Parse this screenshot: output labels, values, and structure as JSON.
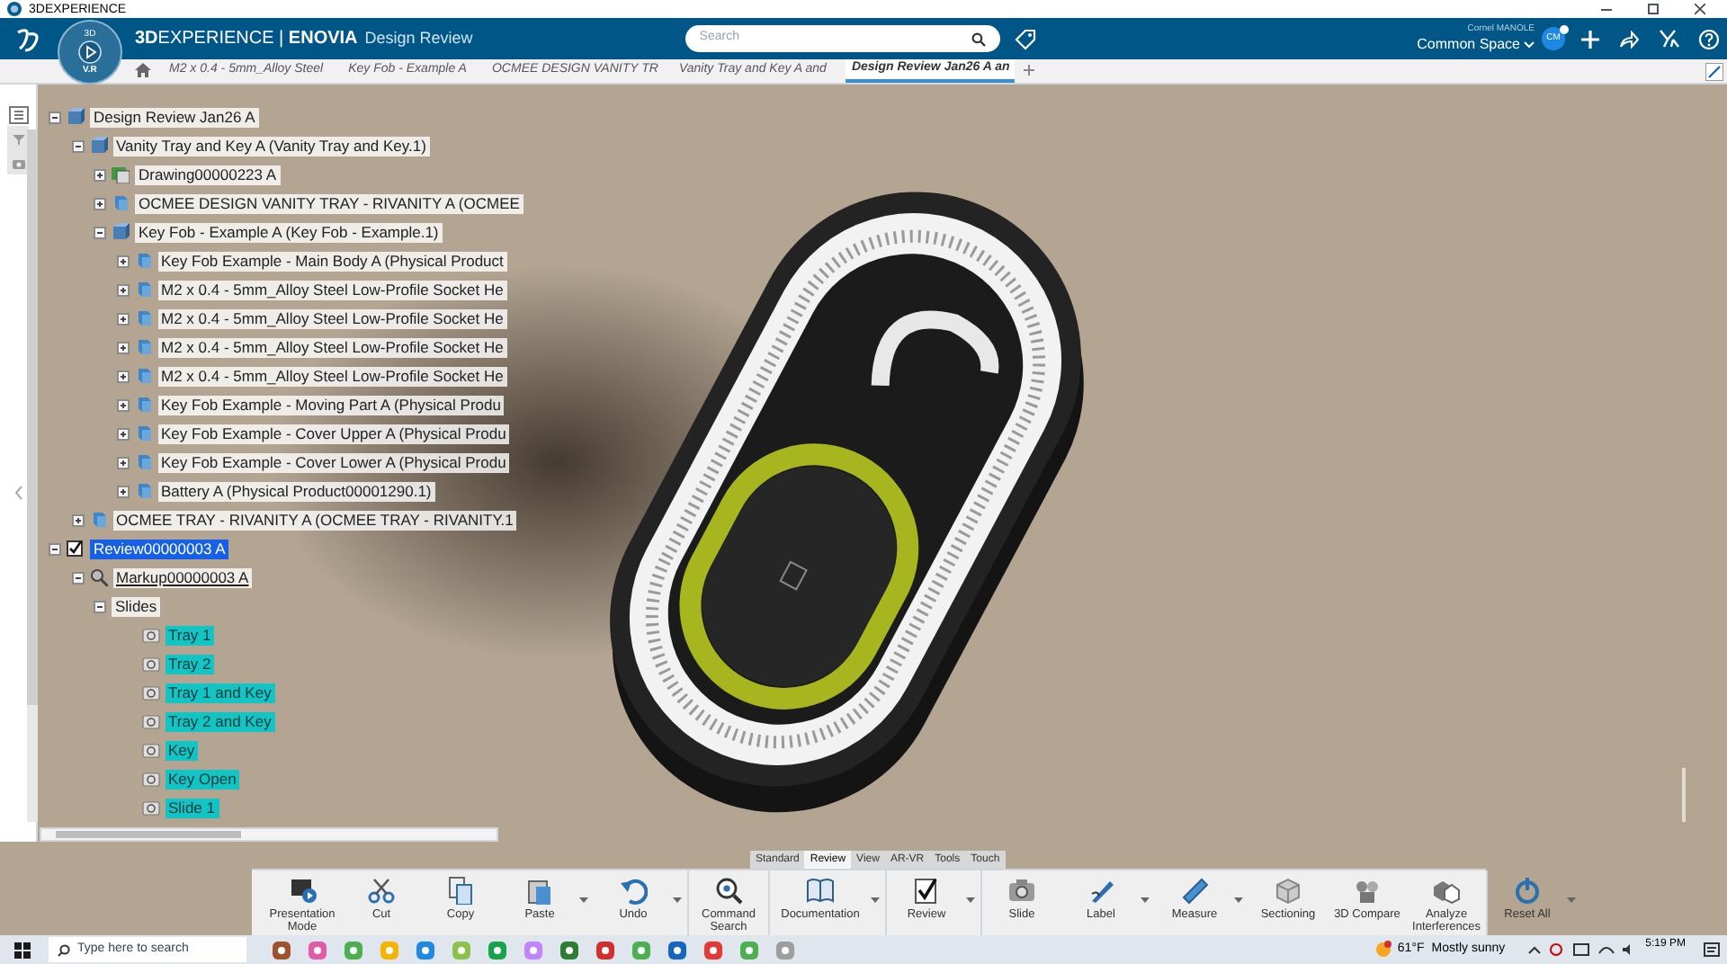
{
  "window": {
    "title": "3DEXPERIENCE"
  },
  "top_bar": {
    "brand": "**3D**EXPERIENCE | **ENOVIA**",
    "app": "Design Review",
    "compass": {
      "top": "3D",
      "bottom": "V.R"
    },
    "search": {
      "placeholder": "Search"
    },
    "user": "Cornel MANOLE",
    "space": "Common Space",
    "avatar": "CM"
  },
  "tabs": [
    {
      "label": "M2 x 0.4 - 5mm_Alloy Steel",
      "selected": false
    },
    {
      "label": "Key Fob - Example A",
      "selected": false
    },
    {
      "label": "OCMEE DESIGN VANITY TR",
      "selected": false
    },
    {
      "label": "Vanity Tray and Key A and",
      "selected": false
    },
    {
      "label": "Design Review Jan26 A an",
      "selected": true
    }
  ],
  "tree": [
    {
      "label": "Design Review Jan26 A",
      "kind": "product",
      "expanded": true,
      "selected": false,
      "children": [
        {
          "label": "Vanity Tray and Key A (Vanity Tray and Key.1)",
          "kind": "product",
          "expanded": true,
          "selected": false,
          "children": [
            {
              "label": "Drawing00000223 A",
              "kind": "drawing",
              "expanded": false,
              "selected": false
            },
            {
              "label": "OCMEE DESIGN VANITY TRAY - RIVANITY A (OCMEE",
              "kind": "part",
              "expanded": false,
              "selected": false
            },
            {
              "label": "Key Fob - Example A (Key Fob - Example.1)",
              "kind": "product",
              "expanded": true,
              "selected": false,
              "children": [
                {
                  "label": "Key Fob Example - Main Body A (Physical Product",
                  "kind": "part",
                  "expanded": false,
                  "selected": false
                },
                {
                  "label": "M2 x 0.4 - 5mm_Alloy Steel Low-Profile Socket He",
                  "kind": "part",
                  "expanded": false,
                  "selected": false
                },
                {
                  "label": "M2 x 0.4 - 5mm_Alloy Steel Low-Profile Socket He",
                  "kind": "part",
                  "expanded": false,
                  "selected": false
                },
                {
                  "label": "M2 x 0.4 - 5mm_Alloy Steel Low-Profile Socket He",
                  "kind": "part",
                  "expanded": false,
                  "selected": false
                },
                {
                  "label": "M2 x 0.4 - 5mm_Alloy Steel Low-Profile Socket He",
                  "kind": "part",
                  "expanded": false,
                  "selected": false
                },
                {
                  "label": "Key Fob Example - Moving Part A (Physical Produ",
                  "kind": "part",
                  "expanded": false,
                  "selected": false
                },
                {
                  "label": "Key Fob Example - Cover Upper A (Physical Produ",
                  "kind": "part",
                  "expanded": false,
                  "selected": false
                },
                {
                  "label": "Key Fob Example - Cover Lower A (Physical Produ",
                  "kind": "part",
                  "expanded": false,
                  "selected": false
                },
                {
                  "label": "Battery A (Physical Product00001290.1)",
                  "kind": "part",
                  "expanded": false,
                  "selected": false
                }
              ]
            }
          ]
        },
        {
          "label": "OCMEE TRAY - RIVANITY A (OCMEE TRAY - RIVANITY.1",
          "kind": "part",
          "expanded": false,
          "selected": false
        }
      ]
    },
    {
      "label": "Review00000003 A",
      "kind": "review",
      "expanded": true,
      "selected": true,
      "children": [
        {
          "label": "Markup00000003 A",
          "kind": "markup",
          "expanded": true,
          "selected": false,
          "children": [
            {
              "label": "Slides",
              "kind": "folder",
              "expanded": true,
              "selected": false,
              "children": [
                {
                  "label": "Tray 1",
                  "kind": "slide",
                  "selected": false
                },
                {
                  "label": "Tray 2",
                  "kind": "slide",
                  "selected": false
                },
                {
                  "label": "Tray 1 and Key",
                  "kind": "slide",
                  "selected": false
                },
                {
                  "label": "Tray 2 and Key",
                  "kind": "slide",
                  "selected": false
                },
                {
                  "label": "Key",
                  "kind": "slide",
                  "selected": false
                },
                {
                  "label": "Key Open",
                  "kind": "slide",
                  "selected": false
                },
                {
                  "label": "Slide 1",
                  "kind": "slide",
                  "selected": false
                }
              ]
            }
          ]
        }
      ]
    }
  ],
  "toolbar_tabs": [
    {
      "label": "Standard",
      "selected": false
    },
    {
      "label": "Review",
      "selected": true
    },
    {
      "label": "View",
      "selected": false
    },
    {
      "label": "AR-VR",
      "selected": false
    },
    {
      "label": "Tools",
      "selected": false
    },
    {
      "label": "Touch",
      "selected": false
    }
  ],
  "toolbar": [
    [
      {
        "label": "Presentation Mode",
        "dropdown": false
      },
      {
        "label": "Cut",
        "dropdown": false
      },
      {
        "label": "Copy",
        "dropdown": false
      },
      {
        "label": "Paste",
        "dropdown": true
      },
      {
        "label": "Undo",
        "dropdown": true
      }
    ],
    [
      {
        "label": "Command Search",
        "dropdown": false
      }
    ],
    [
      {
        "label": "Documentation",
        "dropdown": true
      }
    ],
    [
      {
        "label": "Review",
        "dropdown": true
      }
    ],
    [
      {
        "label": "Slide",
        "dropdown": false
      },
      {
        "label": "Label",
        "dropdown": true
      },
      {
        "label": "Measure",
        "dropdown": true
      },
      {
        "label": "Sectioning",
        "dropdown": false
      },
      {
        "label": "3D Compare",
        "dropdown": false
      },
      {
        "label": "Analyze Interferences",
        "dropdown": false
      }
    ],
    [
      {
        "label": "Reset All",
        "dropdown": true
      }
    ]
  ],
  "taskbar": {
    "search": {
      "placeholder": "Type here to search"
    },
    "weather": {
      "temperature": "61°F",
      "condition": "Mostly sunny"
    },
    "time": "5:19 PM"
  }
}
